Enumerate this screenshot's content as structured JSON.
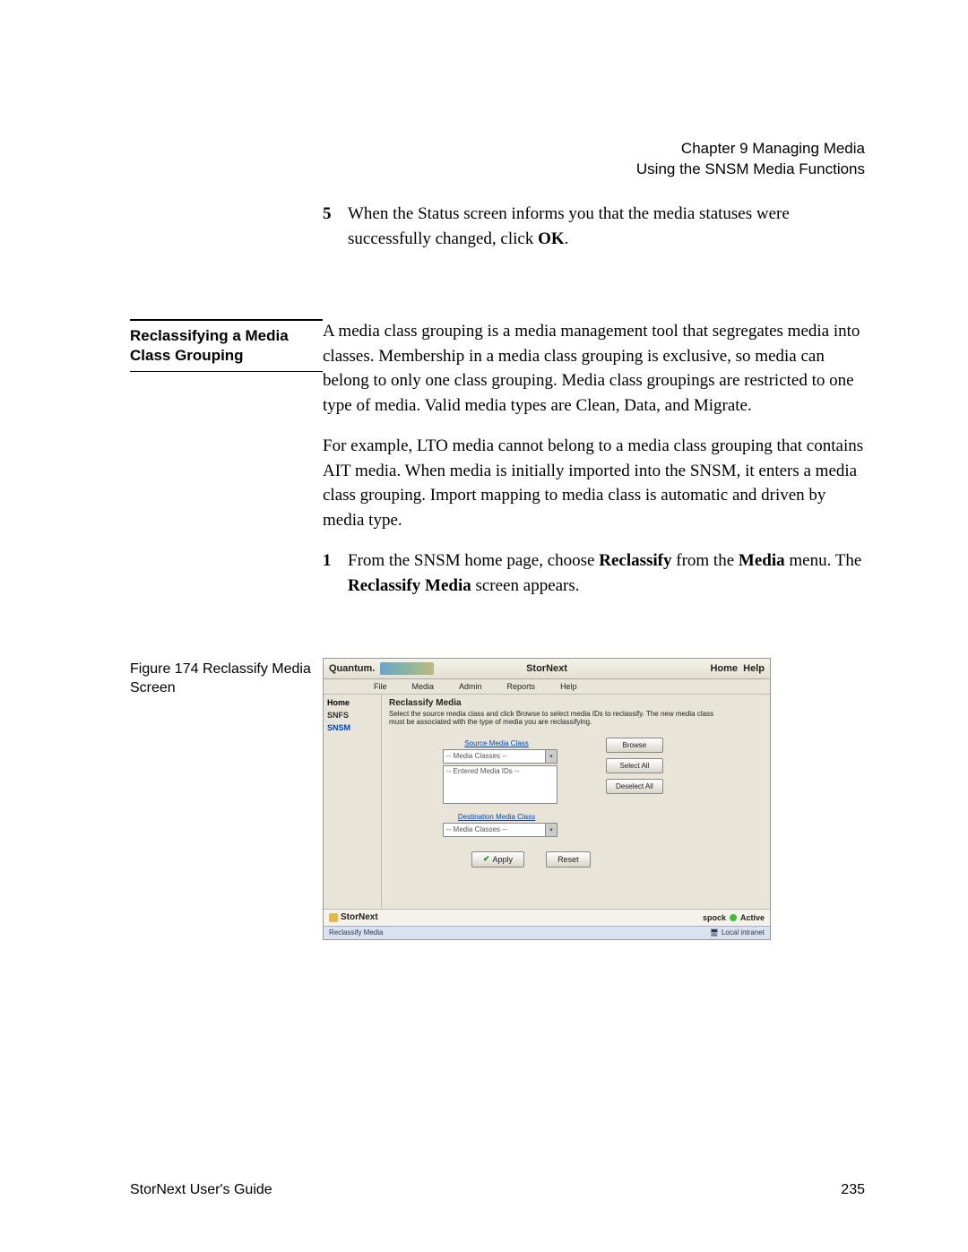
{
  "header": {
    "line1": "Chapter 9  Managing Media",
    "line2": "Using the SNSM Media Functions"
  },
  "step5": {
    "num": "5",
    "text_a": "When the Status screen informs you that the media statuses were successfully changed, click ",
    "text_b": "OK",
    "text_c": "."
  },
  "section": {
    "title": "Reclassifying a Media Class Grouping",
    "para1": "A media class grouping is a media management tool that segregates media into classes. Membership in a media class grouping is exclusive, so media can belong to only one class grouping. Media class groupings are restricted to one type of media. Valid media types are Clean, Data, and Migrate.",
    "para2": "For example, LTO media cannot belong to a media class grouping that contains AIT media. When media is initially imported into the SNSM, it enters a media class grouping. Import mapping to media class is automatic and driven by media type."
  },
  "step1": {
    "num": "1",
    "a": "From the SNSM home page, choose ",
    "b": "Reclassify",
    "c": " from the ",
    "d": "Media",
    "e": " menu. The ",
    "f": "Reclassify Media",
    "g": " screen appears."
  },
  "figure_caption": "Figure 174  Reclassify Media Screen",
  "app": {
    "brand": "Quantum.",
    "title": "StorNext",
    "home": "Home",
    "help": "Help",
    "menu": {
      "file": "File",
      "media": "Media",
      "admin": "Admin",
      "reports": "Reports",
      "help": "Help"
    },
    "side": {
      "home": "Home",
      "snfs": "SNFS",
      "snsm": "SNSM"
    },
    "panel": {
      "title": "Reclassify Media",
      "desc": "Select the source media class and click Browse to select media IDs to reclassify. The new media class must be associated with the type of media you are reclassifying.",
      "src_label": "Source Media Class",
      "src_sel": "-- Media Classes --",
      "entered": "-- Entered Media IDs --",
      "dst_label": "Destination Media Class",
      "dst_sel": "-- Media Classes --",
      "browse": "Browse",
      "select_all": "Select All",
      "deselect_all": "Deselect All",
      "apply": "Apply",
      "reset": "Reset"
    },
    "footer_brand": "StorNext",
    "host": "spock",
    "state": "Active",
    "statusline_left": "Reclassify Media",
    "statusline_right": "Local intranet"
  },
  "footer": {
    "left": "StorNext User's Guide",
    "right": "235"
  }
}
